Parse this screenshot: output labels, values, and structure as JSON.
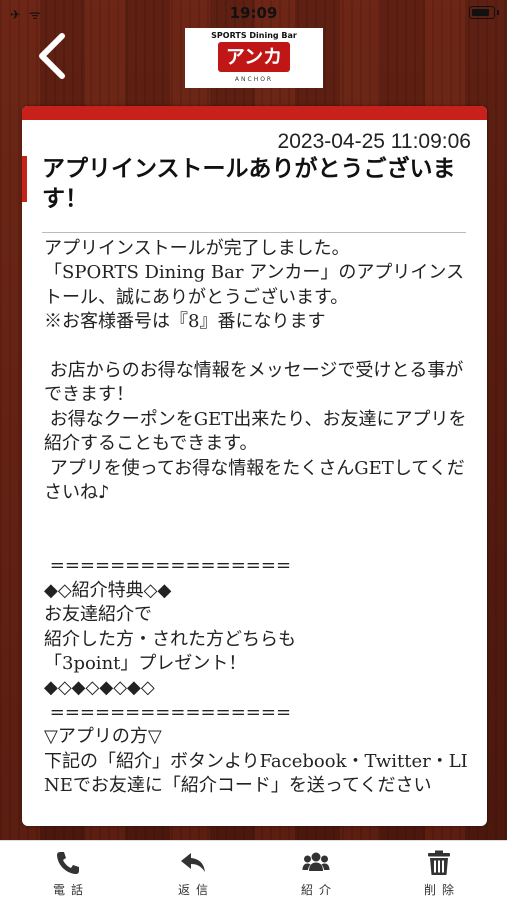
{
  "status_bar": {
    "icons": "✈ ᯤ",
    "time": "19:09"
  },
  "header": {
    "back_icon": "chevron-left-icon",
    "logo": {
      "top_text": "SPORTS Dining Bar",
      "main_text": "アンカー",
      "sub_text": "ANCHOR"
    }
  },
  "message": {
    "timestamp": "2023-04-25 11:09:06",
    "title": "アプリインストールありがとうございます！",
    "body": "アプリインストールが完了しました。\n「SPORTS Dining Bar アンカー」のアプリインストール、誠にありがとうございます。\n※お客様番号は『8』番になります\n\n お店からのお得な情報をメッセージで受けとる事ができます！\n お得なクーポンをGET出来たり、お友達にアプリを紹介することもできます。\n アプリを使ってお得な情報をたくさんGETしてくださいね♪\n\n\n ================\n◆◇紹介特典◇◆\nお友達紹介で\n紹介した方・された方どちらも\n「3point」プレゼント！\n◆◇◆◇◆◇◆◇\n ================\n▽アプリの方▽\n下記の「紹介」ボタンよりFacebook・Twitter・LINEでお友達に「紹介コード」を送ってください"
  },
  "tabbar": {
    "items": [
      {
        "label": "電話",
        "icon": "phone-icon"
      },
      {
        "label": "返信",
        "icon": "reply-icon"
      },
      {
        "label": "紹介",
        "icon": "users-icon"
      },
      {
        "label": "削除",
        "icon": "trash-icon"
      }
    ]
  },
  "colors": {
    "accent_red": "#c8201b",
    "wood_brown": "#5d1f12"
  }
}
